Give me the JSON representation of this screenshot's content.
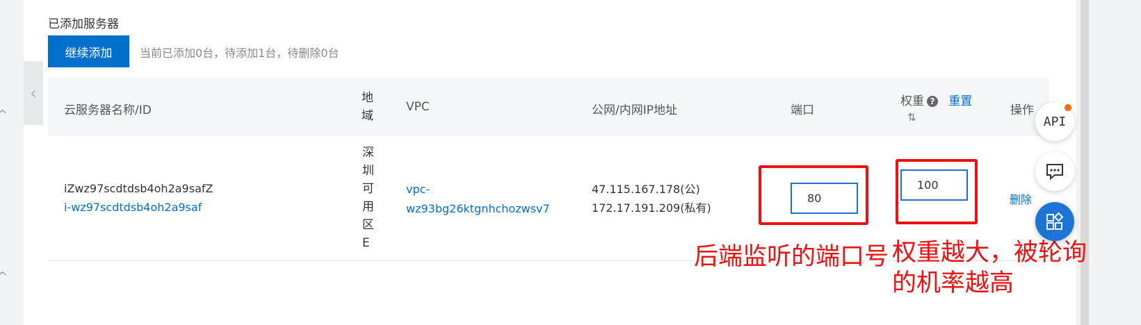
{
  "section": {
    "title": "已添加服务器",
    "continue_button": "继续添加",
    "status": "当前已添加0台，待添加1台，待删除0台"
  },
  "table": {
    "headers": {
      "name": "云服务器名称/ID",
      "region": "地域",
      "vpc": "VPC",
      "ip": "公网/内网IP地址",
      "port": "端口",
      "weight": "权重",
      "reset": "重置",
      "action": "操作"
    },
    "rows": [
      {
        "name": "iZwz97scdtdsb4oh2a9safZ",
        "id": "i-wz97scdtdsb4oh2a9saf",
        "region": "深圳可用区E",
        "vpc_line1": "vpc-",
        "vpc_line2": "wz93bg26ktgnhchozwsv7",
        "ip_public": "47.115.167.178(公)",
        "ip_private": "172.17.191.209(私有)",
        "port": "80",
        "weight": "100",
        "delete": "删除"
      }
    ]
  },
  "annotations": {
    "port_note": "后端监听的端口号",
    "weight_note_line1": "权重越大，被轮询",
    "weight_note_line2": "的机率越高"
  },
  "floating": {
    "api_label": "API"
  },
  "colors": {
    "primary": "#0070cc",
    "annotation_red": "#ee1111",
    "badge_orange": "#ff6a00"
  },
  "icons": [
    "chevron-left-icon",
    "help-icon",
    "sort-icon",
    "chat-icon",
    "apps-icon"
  ]
}
